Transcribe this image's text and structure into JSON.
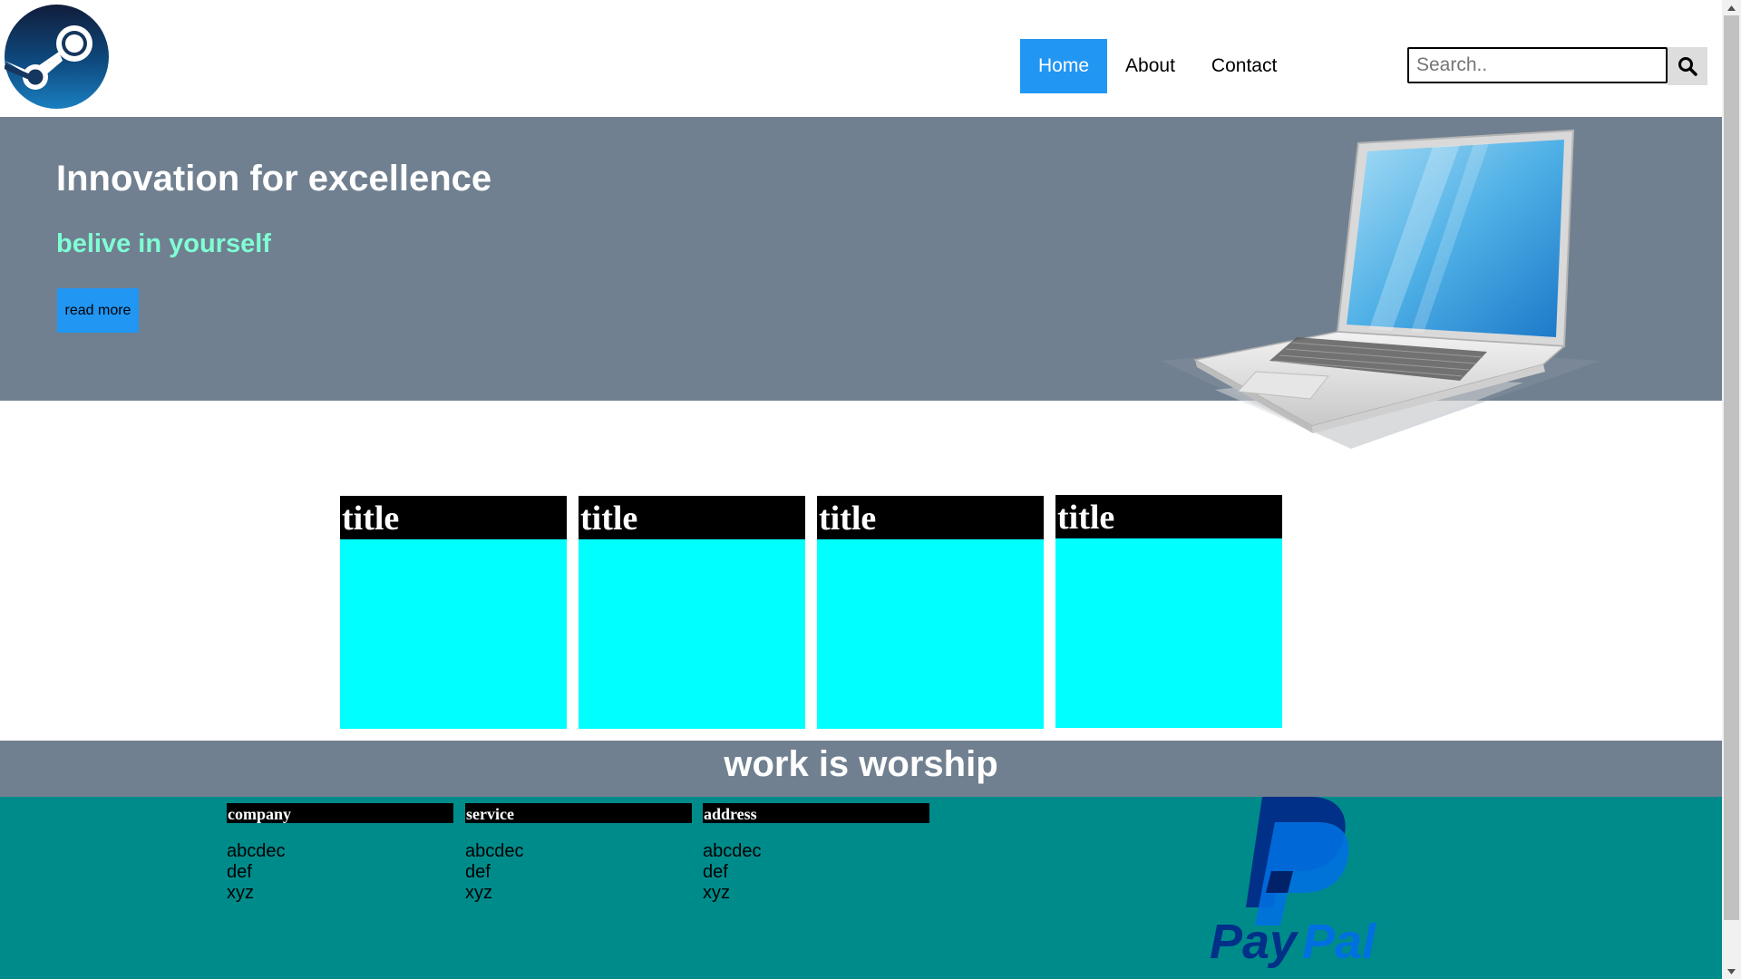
{
  "header": {
    "logo": {
      "icon": "steam-logo-icon"
    },
    "nav": [
      {
        "label": "Home",
        "active": true
      },
      {
        "label": "About",
        "active": false
      },
      {
        "label": "Contact",
        "active": false
      }
    ],
    "search": {
      "placeholder": "Search..",
      "value": "",
      "icon": "search-icon"
    }
  },
  "hero": {
    "title": "Innovation for excellence",
    "subtitle": "belive in yourself",
    "button_label": "read more",
    "image": "laptop-image",
    "background": "#708090",
    "subtitle_color": "#7fffd4",
    "button_color": "#2196f3"
  },
  "cards": [
    {
      "title": "title"
    },
    {
      "title": "title"
    },
    {
      "title": "title"
    },
    {
      "title": "title"
    }
  ],
  "tagline": "work is worship",
  "footer": {
    "background": "#008b8b",
    "columns": [
      {
        "heading": "company",
        "items": [
          "abcdec",
          "def",
          "xyz"
        ]
      },
      {
        "heading": "service",
        "items": [
          "abcdec",
          "def",
          "xyz"
        ]
      },
      {
        "heading": "address",
        "items": [
          "abcdec",
          "def",
          "xyz"
        ]
      }
    ],
    "logo": {
      "icon": "paypal-logo-icon",
      "text": "PayPal"
    }
  },
  "colors": {
    "accent": "#2196f3",
    "card": "#00ffff",
    "bar": "#708090",
    "footer": "#008b8b"
  }
}
